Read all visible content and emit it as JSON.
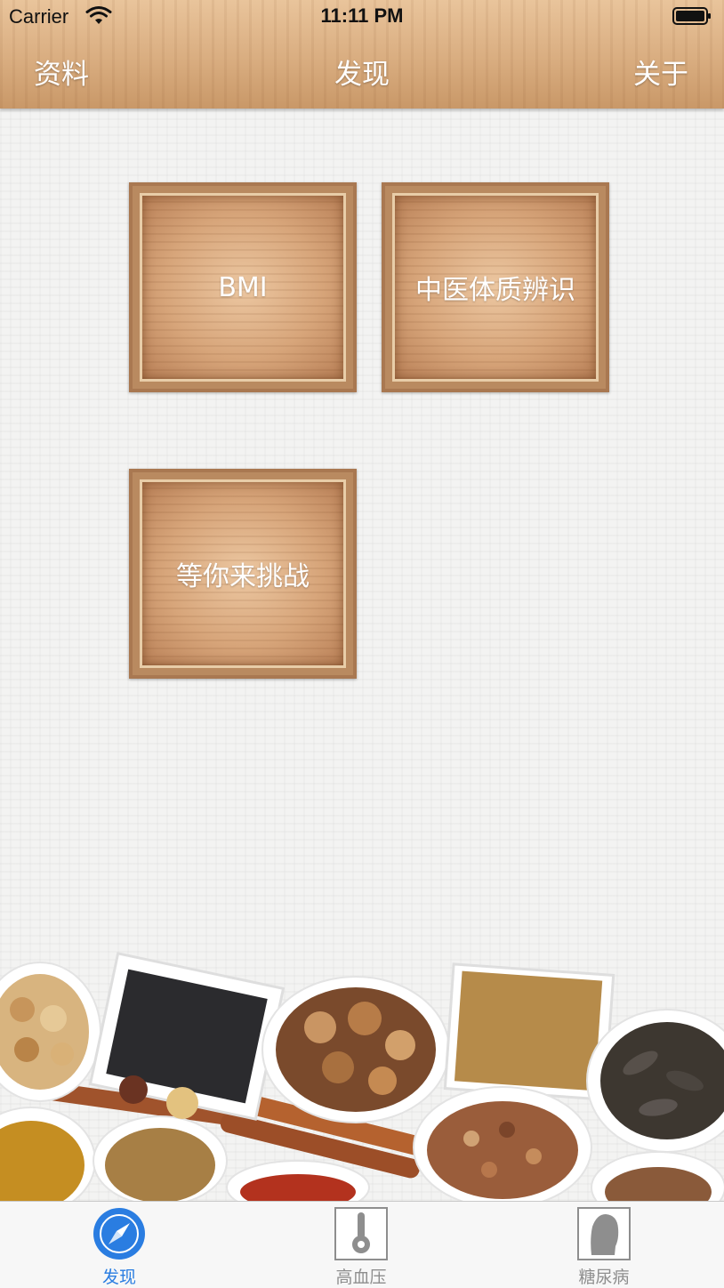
{
  "status_bar": {
    "carrier": "Carrier",
    "time": "11:11 PM"
  },
  "nav": {
    "left": "资料",
    "title": "发现",
    "right": "关于"
  },
  "tiles": [
    {
      "label": "BMI"
    },
    {
      "label": "中医体质辨识"
    },
    {
      "label": "等你来挑战"
    }
  ],
  "tabbar": {
    "items": [
      {
        "label": "发现",
        "icon": "compass-icon",
        "selected": true
      },
      {
        "label": "高血压",
        "icon": "thermometer-icon",
        "selected": false
      },
      {
        "label": "糖尿病",
        "icon": "head-silhouette-icon",
        "selected": false
      }
    ],
    "active_color": "#2a7de1",
    "inactive_color": "#8e8e8e"
  },
  "colors": {
    "header_wood": "#d9ad80",
    "tile_frame": "#a97851",
    "background": "#f3f3f2"
  }
}
